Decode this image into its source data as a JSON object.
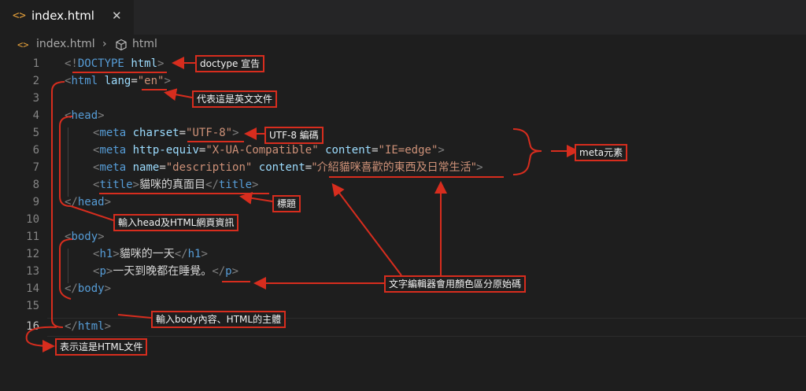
{
  "tab": {
    "icon": "code-file-icon",
    "label": "index.html",
    "close": "✕"
  },
  "breadcrumb": {
    "file_icon": "code-file-icon",
    "file": "index.html",
    "separator": "›",
    "element_icon": "cube-icon",
    "element": "html"
  },
  "editor": {
    "active_line": 16,
    "line_numbers": [
      "1",
      "2",
      "3",
      "4",
      "5",
      "6",
      "7",
      "8",
      "9",
      "10",
      "11",
      "12",
      "13",
      "14",
      "15",
      "16"
    ]
  },
  "code": {
    "l1": [
      "<!",
      "DOCTYPE",
      " ",
      "html",
      ">"
    ],
    "l2": [
      "<",
      "html",
      " ",
      "lang",
      "=",
      "\"en\"",
      ">"
    ],
    "l4": [
      "<",
      "head",
      ">"
    ],
    "l5": [
      "<",
      "meta",
      " ",
      "charset",
      "=",
      "\"UTF-8\"",
      ">"
    ],
    "l6": [
      "<",
      "meta",
      " ",
      "http-equiv",
      "=",
      "\"X-UA-Compatible\"",
      " ",
      "content",
      "=",
      "\"IE=edge\"",
      ">"
    ],
    "l7": [
      "<",
      "meta",
      " ",
      "name",
      "=",
      "\"description\"",
      " ",
      "content",
      "=",
      "\"介紹貓咪喜歡的東西及日常生活\"",
      ">"
    ],
    "l8": [
      "<",
      "title",
      ">",
      "貓咪的真面目",
      "</",
      "title",
      ">"
    ],
    "l9": [
      "</",
      "head",
      ">"
    ],
    "l11": [
      "<",
      "body",
      ">"
    ],
    "l12": [
      "<",
      "h1",
      ">",
      "貓咪的一天",
      "</",
      "h1",
      ">"
    ],
    "l13": [
      "<",
      "p",
      ">",
      "一天到晚都在睡覺。",
      "</",
      "p",
      ">"
    ],
    "l14": [
      "</",
      "body",
      ">"
    ],
    "l16": [
      "</",
      "html",
      ">"
    ]
  },
  "annotations": {
    "doctype": "doctype 宣告",
    "lang_en": "代表這是英文文件",
    "utf8": "UTF-8 編碼",
    "meta": "meta元素",
    "title": "標題",
    "head": "輸入head及HTML網頁資訊",
    "colors": "文字編輯器會用顏色區分原始碼",
    "body": "輸入body內容、HTML的主體",
    "html_doc": "表示這是HTML文件"
  },
  "colors": {
    "annotation": "#d72d1e",
    "tag": "#569cd6",
    "attribute": "#9cdcfe",
    "string": "#ce9178",
    "bracket": "#808080"
  }
}
